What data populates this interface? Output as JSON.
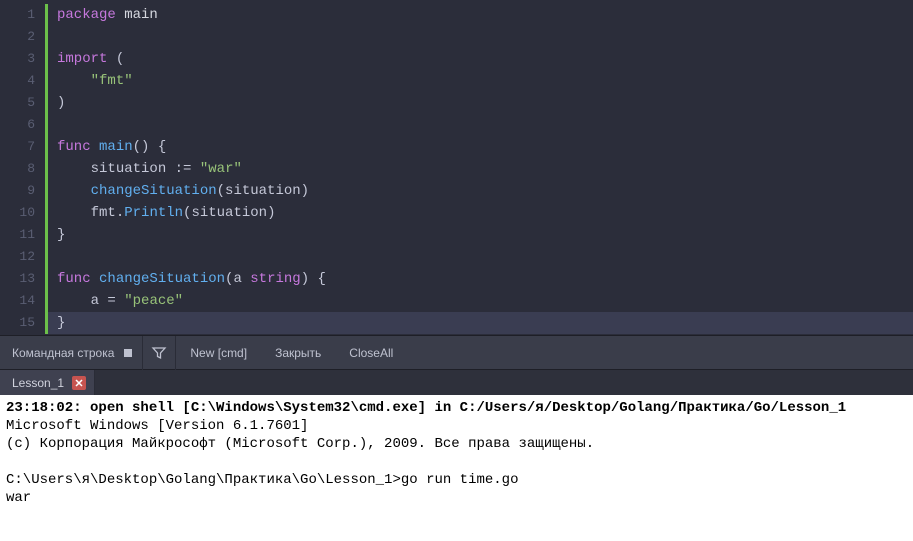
{
  "editor": {
    "gutter": [
      "1",
      "2",
      "3",
      "4",
      "5",
      "6",
      "7",
      "8",
      "9",
      "10",
      "11",
      "12",
      "13",
      "14",
      "15"
    ],
    "lines": [
      {
        "tokens": [
          {
            "t": "kw",
            "v": "package"
          },
          {
            "t": "sp",
            "v": " "
          },
          {
            "t": "pkg",
            "v": "main"
          }
        ]
      },
      {
        "tokens": []
      },
      {
        "tokens": [
          {
            "t": "kw",
            "v": "import"
          },
          {
            "t": "sp",
            "v": " "
          },
          {
            "t": "paren",
            "v": "("
          }
        ]
      },
      {
        "tokens": [
          {
            "t": "sp",
            "v": "    "
          },
          {
            "t": "str",
            "v": "\"fmt\""
          }
        ]
      },
      {
        "tokens": [
          {
            "t": "paren",
            "v": ")"
          }
        ]
      },
      {
        "tokens": []
      },
      {
        "tokens": [
          {
            "t": "kw",
            "v": "func"
          },
          {
            "t": "sp",
            "v": " "
          },
          {
            "t": "fn",
            "v": "main"
          },
          {
            "t": "paren",
            "v": "()"
          },
          {
            "t": "sp",
            "v": " "
          },
          {
            "t": "paren",
            "v": "{"
          }
        ]
      },
      {
        "tokens": [
          {
            "t": "sp",
            "v": "    "
          },
          {
            "t": "id",
            "v": "situation"
          },
          {
            "t": "sp",
            "v": " "
          },
          {
            "t": "op",
            "v": ":="
          },
          {
            "t": "sp",
            "v": " "
          },
          {
            "t": "str",
            "v": "\"war\""
          }
        ]
      },
      {
        "tokens": [
          {
            "t": "sp",
            "v": "    "
          },
          {
            "t": "fn",
            "v": "changeSituation"
          },
          {
            "t": "paren",
            "v": "("
          },
          {
            "t": "id",
            "v": "situation"
          },
          {
            "t": "paren",
            "v": ")"
          }
        ]
      },
      {
        "tokens": [
          {
            "t": "sp",
            "v": "    "
          },
          {
            "t": "id",
            "v": "fmt"
          },
          {
            "t": "dot",
            "v": "."
          },
          {
            "t": "fn",
            "v": "Println"
          },
          {
            "t": "paren",
            "v": "("
          },
          {
            "t": "id",
            "v": "situation"
          },
          {
            "t": "paren",
            "v": ")"
          }
        ]
      },
      {
        "tokens": [
          {
            "t": "paren",
            "v": "}"
          }
        ]
      },
      {
        "tokens": []
      },
      {
        "tokens": [
          {
            "t": "kw",
            "v": "func"
          },
          {
            "t": "sp",
            "v": " "
          },
          {
            "t": "fn",
            "v": "changeSituation"
          },
          {
            "t": "paren",
            "v": "("
          },
          {
            "t": "id",
            "v": "a"
          },
          {
            "t": "sp",
            "v": " "
          },
          {
            "t": "typ",
            "v": "string"
          },
          {
            "t": "paren",
            "v": ")"
          },
          {
            "t": "sp",
            "v": " "
          },
          {
            "t": "paren",
            "v": "{"
          }
        ]
      },
      {
        "tokens": [
          {
            "t": "sp",
            "v": "    "
          },
          {
            "t": "id",
            "v": "a"
          },
          {
            "t": "sp",
            "v": " "
          },
          {
            "t": "op",
            "v": "="
          },
          {
            "t": "sp",
            "v": " "
          },
          {
            "t": "str",
            "v": "\"peace\""
          }
        ]
      },
      {
        "cursor": true,
        "tokens": [
          {
            "t": "paren",
            "v": "}"
          }
        ]
      }
    ]
  },
  "toolbar": {
    "title": "Командная строка",
    "new": "New [cmd]",
    "close": "Закрыть",
    "closeAll": "CloseAll"
  },
  "tabs": {
    "active": "Lesson_1"
  },
  "terminal": {
    "lines": [
      {
        "bold": true,
        "text": "23:18:02: open shell [C:\\Windows\\System32\\cmd.exe] in C:/Users/я/Desktop/Golang/Практика/Go/Lesson_1"
      },
      {
        "text": "Microsoft Windows [Version 6.1.7601]"
      },
      {
        "text": "(c) Корпорация Майкрософт (Microsoft Corp.), 2009. Все права защищены."
      },
      {
        "text": ""
      },
      {
        "text": "C:\\Users\\я\\Desktop\\Golang\\Практика\\Go\\Lesson_1>go run time.go"
      },
      {
        "text": "war"
      }
    ]
  }
}
